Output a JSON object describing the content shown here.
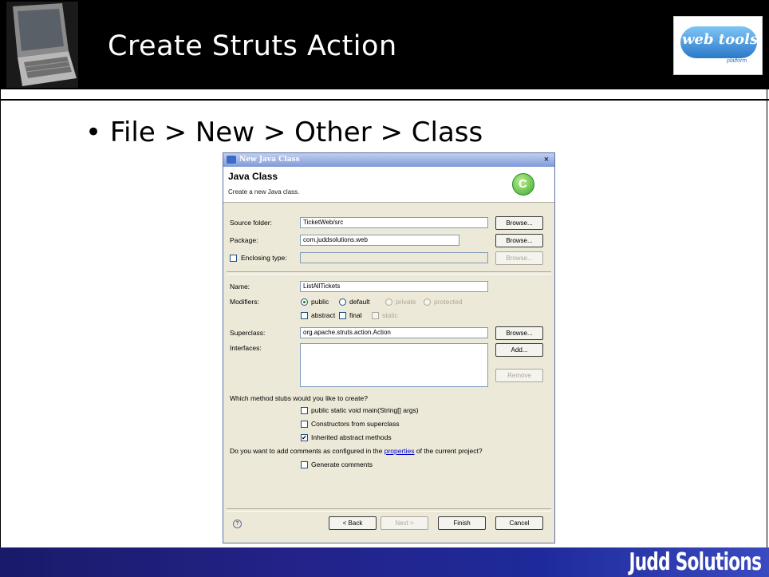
{
  "slide": {
    "title": "Create Struts Action",
    "bullet": "File > New > Other > Class",
    "footer_brand": "Judd Solutions",
    "logo_text": "web tools",
    "logo_sub": "platform"
  },
  "dialog": {
    "window_title": "New Java Class",
    "close_glyph": "×",
    "banner_title": "Java Class",
    "banner_subtitle": "Create a new Java class.",
    "banner_icon_glyph": "C",
    "source_folder_label": "Source folder:",
    "source_folder_value": "TicketWeb/src",
    "package_label": "Package:",
    "package_value": "com.juddsolutions.web",
    "enclosing_label": "Enclosing type:",
    "enclosing_value": "",
    "browse_label": "Browse...",
    "name_label": "Name:",
    "name_value": "ListAllTickets",
    "modifiers_label": "Modifiers:",
    "mod_public": "public",
    "mod_default": "default",
    "mod_private": "private",
    "mod_protected": "protected",
    "mod_abstract": "abstract",
    "mod_final": "final",
    "mod_static": "static",
    "superclass_label": "Superclass:",
    "superclass_value": "org.apache.struts.action.Action",
    "interfaces_label": "Interfaces:",
    "add_label": "Add...",
    "remove_label": "Remove",
    "stubs_question": "Which method stubs would you like to create?",
    "stub_main": "public static void main(String[] args)",
    "stub_constructors": "Constructors from superclass",
    "stub_inherited": "Inherited abstract methods",
    "comments_question_pre": "Do you want to add comments as configured in the ",
    "comments_link": "properties",
    "comments_question_post": " of the current project?",
    "generate_comments": "Generate comments",
    "check_glyph": "✔",
    "help_glyph": "?",
    "back_label": "< Back",
    "next_label": "Next >",
    "finish_label": "Finish",
    "cancel_label": "Cancel"
  }
}
